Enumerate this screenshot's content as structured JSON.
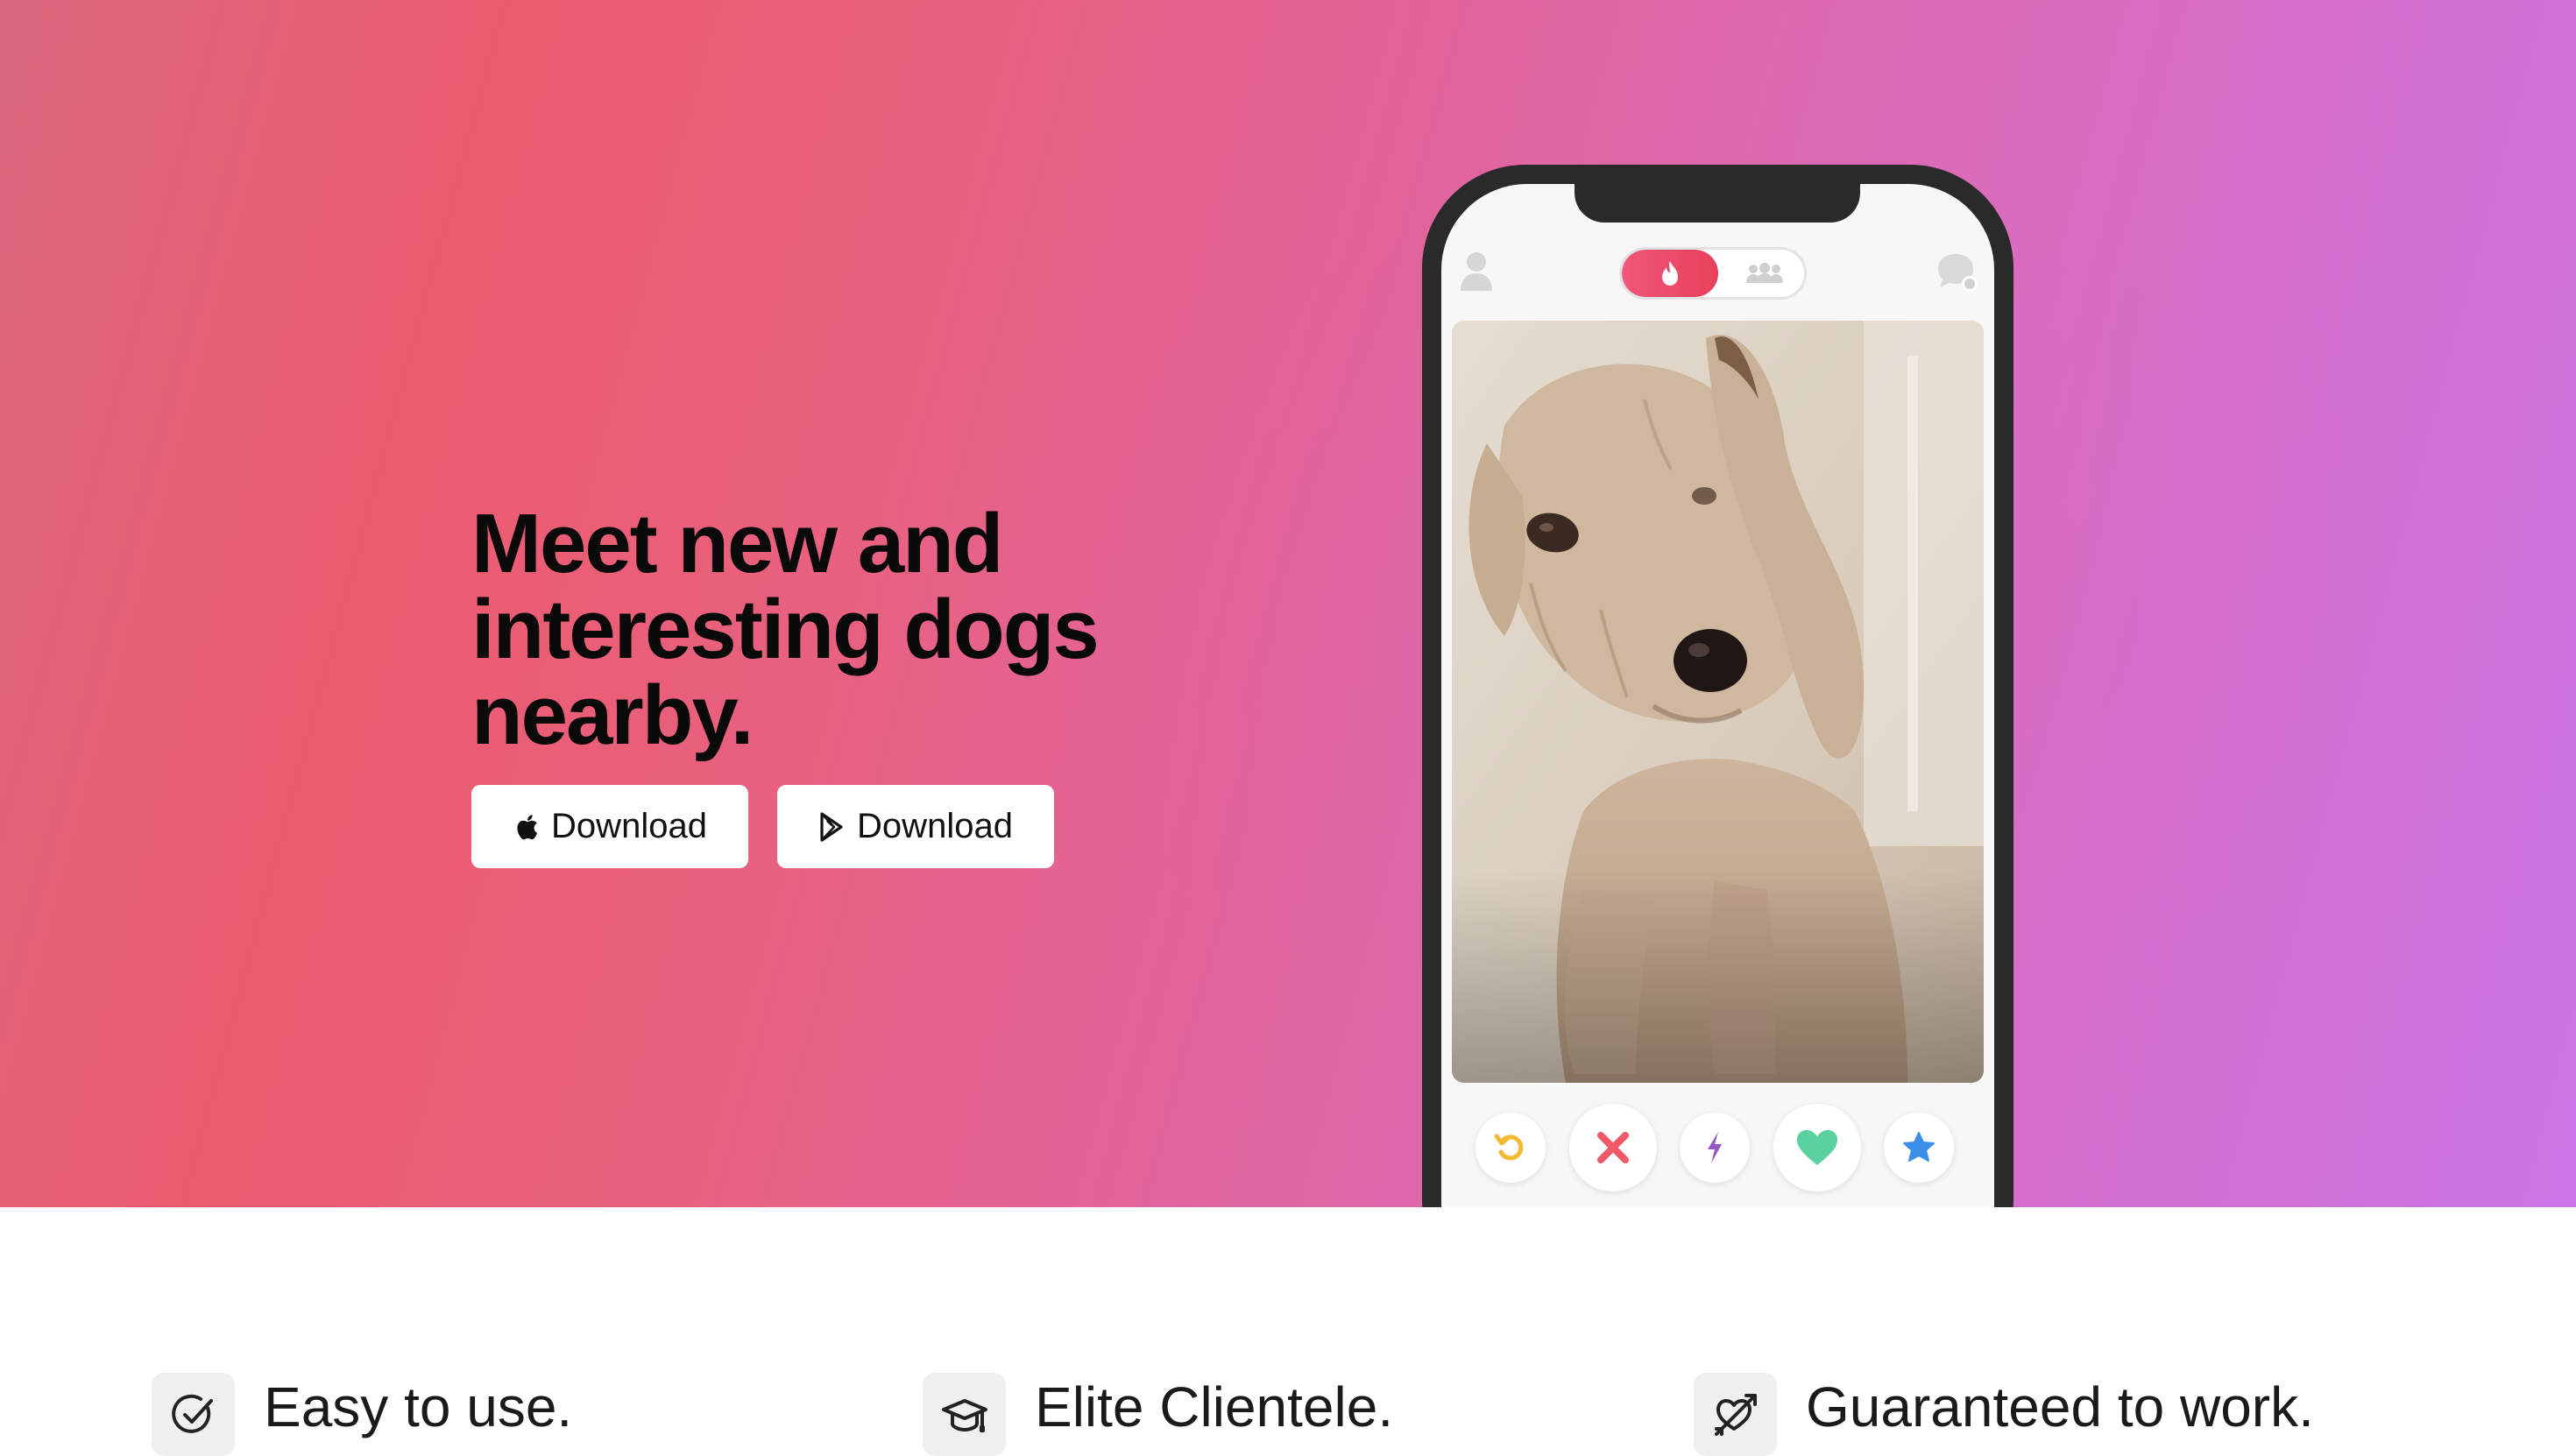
{
  "hero": {
    "headline": "Meet new and interesting dogs nearby.",
    "buttons": [
      {
        "label": "Download",
        "icon": "apple-icon"
      },
      {
        "label": "Download",
        "icon": "google-play-icon"
      }
    ]
  },
  "phone": {
    "toolbar": {
      "left_icon": "profile-icon",
      "toggle_icons": [
        "flame-icon",
        "group-icon"
      ],
      "right_icon": "chat-icon"
    },
    "card_image": "dog-photo",
    "actions": [
      {
        "icon": "rewind-icon",
        "color": "#f5b832"
      },
      {
        "icon": "close-icon",
        "color": "#f0596a"
      },
      {
        "icon": "boost-icon",
        "color": "#9656c6"
      },
      {
        "icon": "heart-icon",
        "color": "#5bd3a0"
      },
      {
        "icon": "star-icon",
        "color": "#3b8ee8"
      }
    ]
  },
  "features": [
    {
      "title": "Easy to use.",
      "icon": "check-circle-icon"
    },
    {
      "title": "Elite Clientele.",
      "icon": "graduation-cap-icon"
    },
    {
      "title": "Guaranteed to work.",
      "icon": "heart-arrow-icon"
    }
  ],
  "colors": {
    "gradient_start": "#ec5b6e",
    "gradient_end": "#cb74e6",
    "button_bg": "#ffffff",
    "feature_icon_bg": "#efefef"
  }
}
